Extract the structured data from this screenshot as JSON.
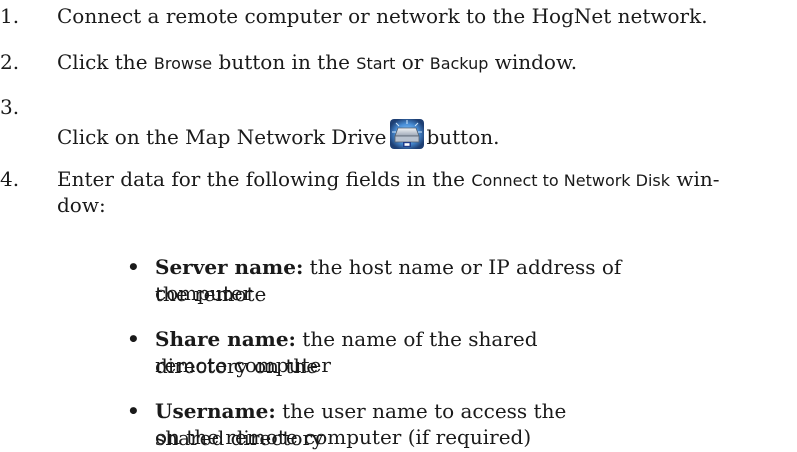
{
  "steps": [
    {
      "number": "1.",
      "text": "Connect a remote computer or network to the HogNet network."
    },
    {
      "number": "2.",
      "pre": "Click the ",
      "ui1": "Browse",
      "mid": " button in the ",
      "ui2": "Start",
      "mid2": " or ",
      "ui3": "Backup",
      "post": " window."
    },
    {
      "number": "3.",
      "pre": "Click on the Map Network Drive",
      "icon": "map-network-drive-icon",
      "post": "button."
    },
    {
      "number": "4.",
      "pre": "Enter data for the following fields in the ",
      "ui1": "Connect to Network Disk",
      "post": " win-",
      "line2": "dow:"
    }
  ],
  "bullets": [
    {
      "symbol": "•",
      "term": "Server name:",
      "desc1": " the host name or IP address of the remote",
      "desc2": "computer"
    },
    {
      "symbol": "•",
      "term": "Share name:",
      "desc1": " the name of the shared directory on the",
      "desc2": "remote computer"
    },
    {
      "symbol": "•",
      "term": "Username:",
      "desc1": " the user name to access the shared directory",
      "desc2": "on the remote computer (if required)"
    }
  ]
}
